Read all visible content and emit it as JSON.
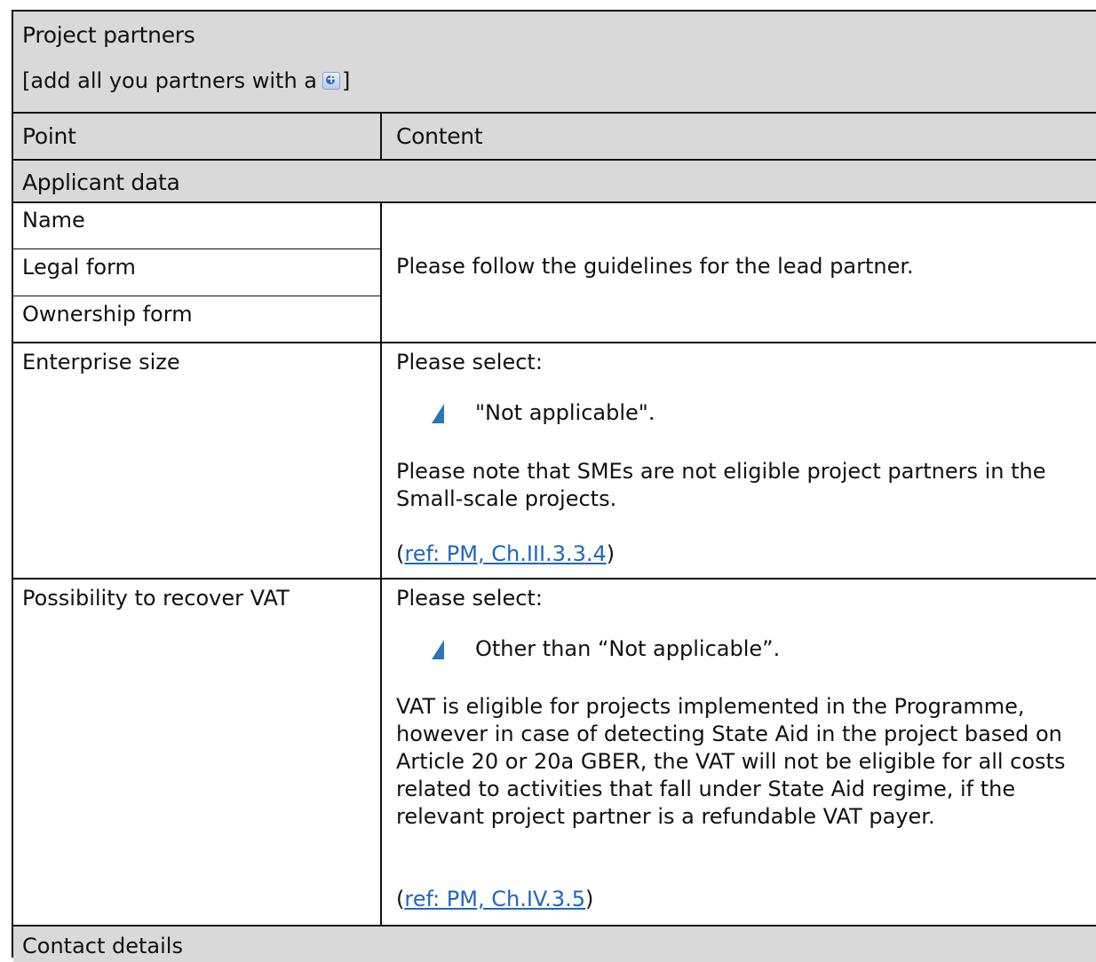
{
  "header": {
    "title": "Project partners",
    "instruction_prefix": "[add all you partners with a",
    "instruction_suffix": "]",
    "add_icon": "add-circle-icon"
  },
  "columns": {
    "point": "Point",
    "content": "Content"
  },
  "sections": {
    "applicant_data": "Applicant data",
    "contact_details": "Contact details"
  },
  "rows": {
    "name": "Name",
    "legal_form": "Legal form",
    "ownership_form": "Ownership form",
    "shared_content": "Please follow the guidelines for the lead partner.",
    "enterprise_size": {
      "label": "Enterprise size",
      "select_prompt": "Please select:",
      "bullet": "\"Not applicable\".",
      "note": "Please note that SMEs are not eligible project partners in the Small-scale projects.",
      "ref_open": "(",
      "ref_link": "ref: PM, Ch.III.3.3.4",
      "ref_close": ")"
    },
    "vat": {
      "label": "Possibility to recover VAT",
      "select_prompt": "Please select:",
      "bullet": "Other than “Not applicable”.",
      "note": "VAT is eligible for projects implemented in the Programme, however in case of detecting State Aid in the project based on Article 20 or 20a GBER, the VAT will not be eligible for all costs related to activities that fall under State Aid regime, if the relevant project partner is a refundable VAT payer.",
      "ref_open": "(",
      "ref_link": "ref: PM, Ch.IV.3.5",
      "ref_close": ")"
    }
  },
  "colors": {
    "header_bg": "#d9d9d9",
    "link": "#1f66c2",
    "bullet": "#2e75b6"
  }
}
